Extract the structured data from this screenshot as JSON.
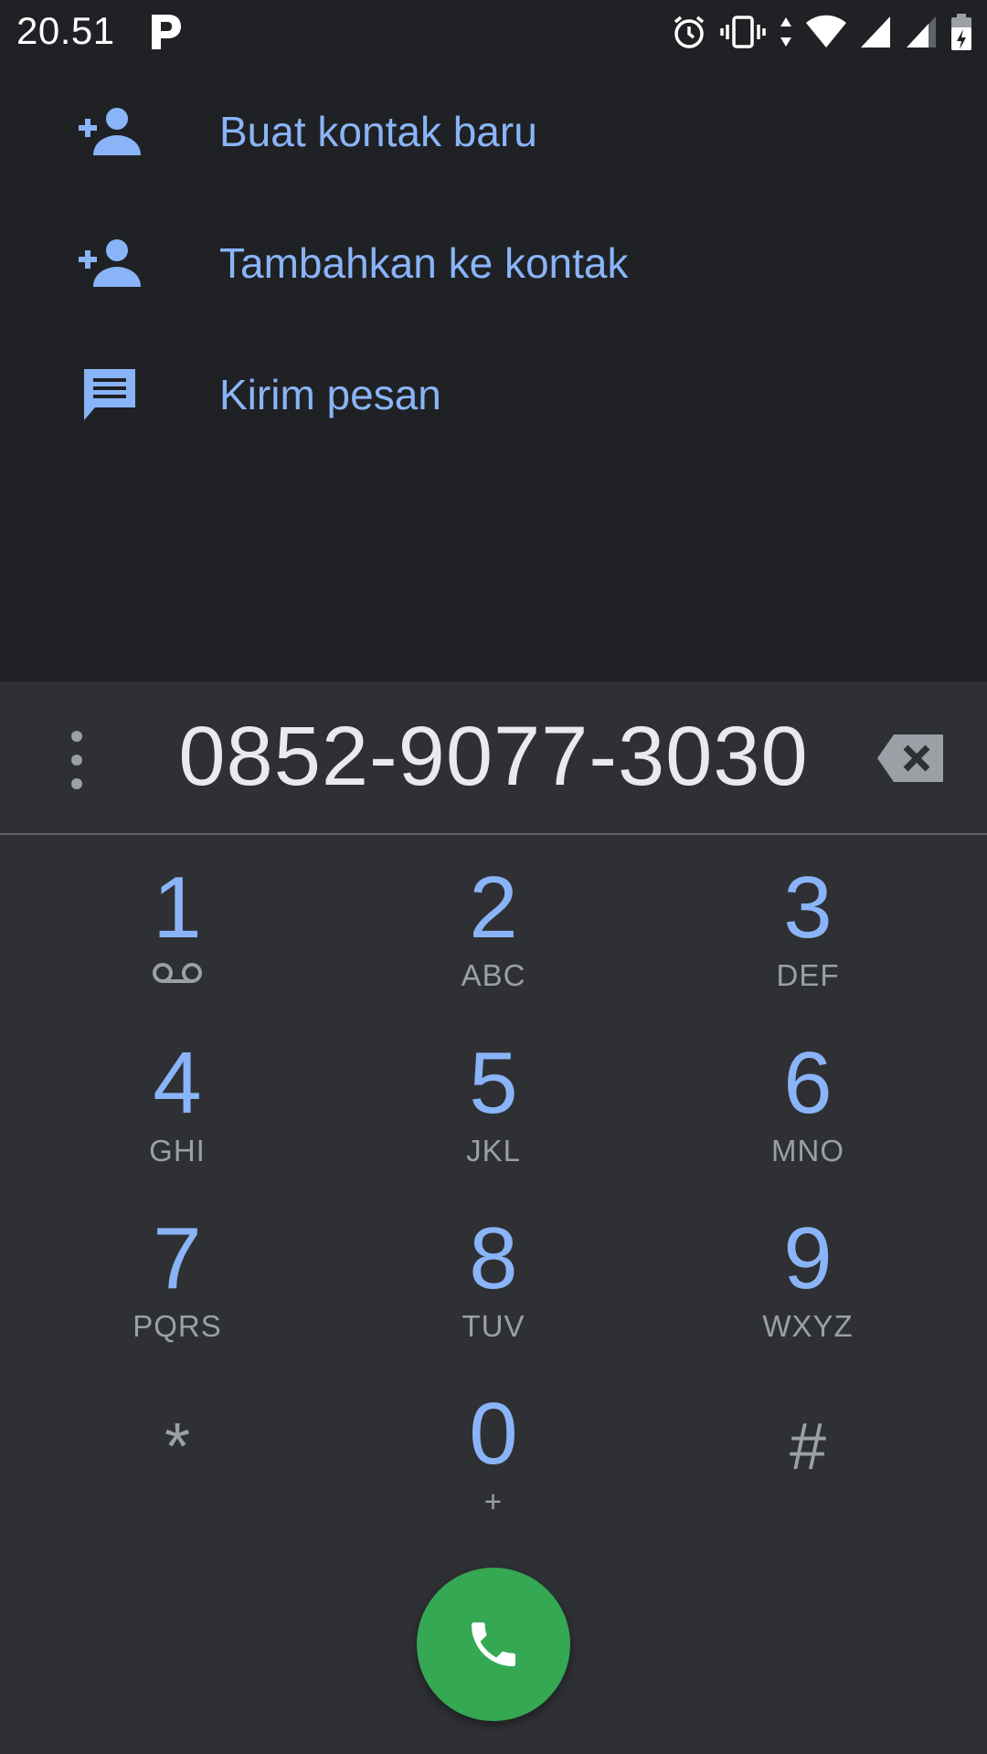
{
  "status_bar": {
    "time": "20.51",
    "icons": [
      "parking-app-icon",
      "alarm-icon",
      "vibrate-icon",
      "data-arrows-icon",
      "wifi-icon",
      "signal-icon",
      "signal-icon-2",
      "battery-charging-icon"
    ]
  },
  "suggestions": [
    {
      "label": "Buat kontak baru",
      "icon": "person-add-icon"
    },
    {
      "label": "Tambahkan ke kontak",
      "icon": "person-add-icon"
    },
    {
      "label": "Kirim pesan",
      "icon": "message-icon"
    }
  ],
  "dialpad": {
    "number": "0852-9077-3030",
    "keys": [
      {
        "digit": "1",
        "letters": "",
        "icon": "voicemail-icon"
      },
      {
        "digit": "2",
        "letters": "ABC"
      },
      {
        "digit": "3",
        "letters": "DEF"
      },
      {
        "digit": "4",
        "letters": "GHI"
      },
      {
        "digit": "5",
        "letters": "JKL"
      },
      {
        "digit": "6",
        "letters": "MNO"
      },
      {
        "digit": "7",
        "letters": "PQRS"
      },
      {
        "digit": "8",
        "letters": "TUV"
      },
      {
        "digit": "9",
        "letters": "WXYZ"
      },
      {
        "digit": "*",
        "letters": ""
      },
      {
        "digit": "0",
        "letters": "+"
      },
      {
        "digit": "#",
        "letters": ""
      }
    ]
  },
  "colors": {
    "background": "#202124",
    "dialpad_bg": "#2f3034",
    "accent": "#8ab4f8",
    "call_green": "#34a853"
  }
}
